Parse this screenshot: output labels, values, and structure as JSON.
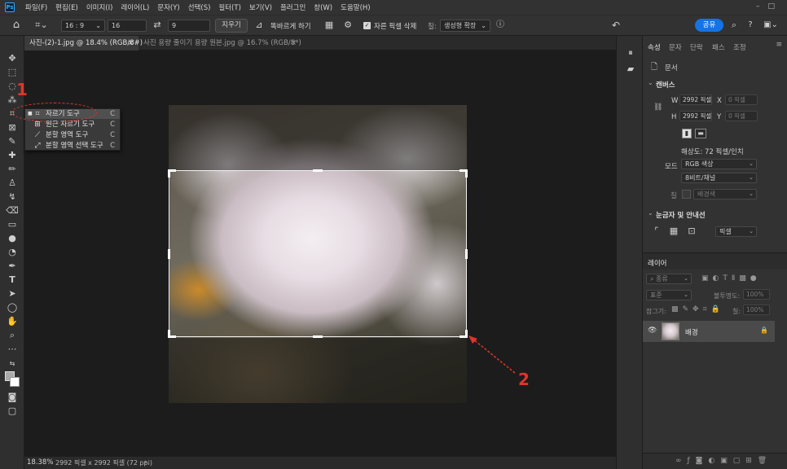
{
  "app": {
    "logo": "Ps"
  },
  "menu": [
    "파일(F)",
    "편집(E)",
    "이미지(I)",
    "레이어(L)",
    "문자(Y)",
    "선택(S)",
    "필터(T)",
    "보기(V)",
    "플러그인",
    "창(W)",
    "도움말(H)"
  ],
  "options": {
    "ratio": "16 : 9",
    "width": "16",
    "height": "9",
    "clear_label": "지우기",
    "straighten_label": "똑바르게 하기",
    "delete_cropped_label": "자른 픽셀 삭제",
    "fill_label": "칠:",
    "fill_value": "생성형 확장",
    "share_label": "공유"
  },
  "tabs": [
    {
      "label": "사진-(2)-1.jpg @ 18.4% (RGB/8#)"
    },
    {
      "label": "사진 용량 줄이기 용량 원본.jpg @ 16.7% (RGB/8*)"
    }
  ],
  "flyout": {
    "items": [
      {
        "label": "자르기 도구",
        "key": "C"
      },
      {
        "label": "원근 자르기 도구",
        "key": "C"
      },
      {
        "label": "분할 영역 도구",
        "key": "C"
      },
      {
        "label": "분할 영역 선택 도구",
        "key": "C"
      }
    ]
  },
  "annotations": {
    "one": "1",
    "two": "2"
  },
  "status": {
    "zoom": "18.38%",
    "info": "2992 픽셀 x 2992 픽셀 (72 ppi)"
  },
  "panel": {
    "tabs": [
      "속성",
      "문자",
      "단락",
      "패스",
      "조정"
    ],
    "doc_label": "문서",
    "canvas_title": "캔버스",
    "w_label": "W",
    "w_value": "2992 픽셀",
    "x_label": "X",
    "x_value": "0 픽셀",
    "h_label": "H",
    "h_value": "2992 픽셀",
    "y_label": "Y",
    "y_value": "0 픽셀",
    "resolution": "해상도: 72 픽셀/인치",
    "mode_label": "모드",
    "mode_value": "RGB 색상",
    "depth_value": "8비트/채널",
    "fill_label": "칠",
    "fill_value": "배경색",
    "rulers_title": "눈금자 및 안내선",
    "ruler_unit": "픽셀"
  },
  "layers": {
    "tab": "레이어",
    "search": "종류",
    "blend": "표준",
    "opacity_label": "불투명도:",
    "opacity_value": "100%",
    "lock_label": "잠그기:",
    "fill_label": "칠:",
    "fill_value": "100%",
    "layer_name": "배경"
  },
  "colors": {
    "accent": "#1473e6",
    "annotation": "#e0352b"
  }
}
